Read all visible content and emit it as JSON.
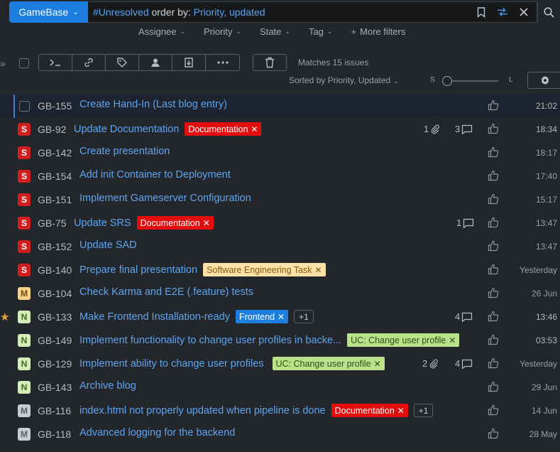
{
  "search": {
    "project": "GameBase",
    "query_hash": "#Unresolved",
    "query_orderby": " order by: ",
    "query_fields": "Priority, updated"
  },
  "filters": [
    "Assignee",
    "Priority",
    "State",
    "Tag",
    "More filters"
  ],
  "toolbar": {
    "matches": "Matches 15 issues",
    "sorted": "Sorted by Priority, Updated",
    "size_small": "S",
    "size_large": "L"
  },
  "colors": {
    "accent": "#1c7fe0",
    "link": "#5ea4ef",
    "priority_show_stopper": "#d11f1f",
    "priority_major": "#f6d28a",
    "priority_normal": "#d3ecb8",
    "priority_minor": "#c9ccd0"
  },
  "issues": [
    {
      "id": "GB-155",
      "summary": "Create Hand-In (Last blog entry)",
      "priority": "",
      "time": "21:02"
    },
    {
      "id": "GB-92",
      "summary": "Update Documentation",
      "priority": "S",
      "tag": "Documentation",
      "attachments": "1",
      "comments": "3",
      "time": "18:34"
    },
    {
      "id": "GB-142",
      "summary": "Create presentation",
      "priority": "S",
      "time": "18:17"
    },
    {
      "id": "GB-154",
      "summary": "Add init Container to Deployment",
      "priority": "S",
      "time": "17:40"
    },
    {
      "id": "GB-151",
      "summary": "Implement Gameserver Configuration",
      "priority": "S",
      "time": "15:17"
    },
    {
      "id": "GB-75",
      "summary": "Update SRS",
      "priority": "S",
      "tag": "Documentation",
      "comments": "1",
      "time": "13:47"
    },
    {
      "id": "GB-152",
      "summary": "Update SAD",
      "priority": "S",
      "time": "13:47"
    },
    {
      "id": "GB-140",
      "summary": "Prepare final presentation",
      "priority": "S",
      "tag": "Software Engineering Task",
      "time": "Yesterday"
    },
    {
      "id": "GB-104",
      "summary": "Check Karma and E2E (.feature) tests",
      "priority": "M",
      "time": "26 Jun"
    },
    {
      "id": "GB-133",
      "summary": "Make Frontend Installation-ready",
      "priority": "N",
      "tag": "Frontend",
      "more": "+1",
      "comments": "4",
      "time": "13:46"
    },
    {
      "id": "GB-149",
      "summary": "Implement functionality to change user profiles in backe...",
      "priority": "N",
      "tag": "UC: Change user profile",
      "time": "03:53"
    },
    {
      "id": "GB-129",
      "summary": "Implement ability to change user profiles",
      "priority": "N",
      "tag": "UC: Change user profile",
      "attachments": "2",
      "comments": "4",
      "time": "Yesterday"
    },
    {
      "id": "GB-143",
      "summary": "Archive blog",
      "priority": "N",
      "time": "29 Jun"
    },
    {
      "id": "GB-116",
      "summary": "index.html not properly updated when pipeline is done",
      "priority": "M",
      "tag": "Documentation",
      "more": "+1",
      "time": "14 Jun"
    },
    {
      "id": "GB-118",
      "summary": "Advanced logging for the backend",
      "priority": "M",
      "time": "28 May"
    }
  ]
}
